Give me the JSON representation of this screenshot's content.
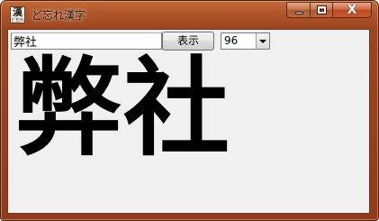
{
  "window": {
    "title": "ど忘れ漢字",
    "icon": {
      "name": "app-kanji-icon",
      "glyph": "漢",
      "sub": "ど忘れ"
    }
  },
  "caption_buttons": {
    "minimize": "minimize-icon",
    "maximize": "maximize-icon",
    "close": "close-icon",
    "close_glyph": "X"
  },
  "toolbar": {
    "input_value": "弊社",
    "show_button_label": "表示",
    "font_size_selected": "96"
  },
  "display": {
    "text": "弊社"
  },
  "colors": {
    "title_bar": "#b0552a",
    "client_background": "#f0f0f0",
    "kanji_color": "#000000"
  }
}
